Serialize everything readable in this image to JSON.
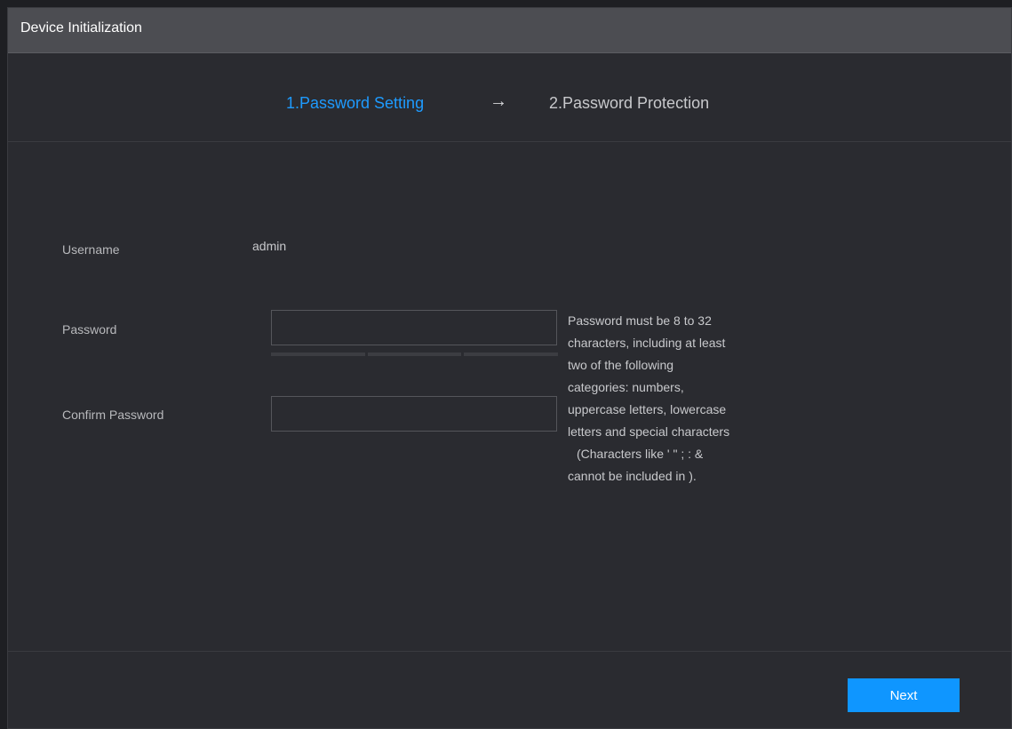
{
  "window": {
    "title": "Device Initialization"
  },
  "steps": {
    "step1": "1.Password Setting",
    "arrow": "→",
    "step2": "2.Password Protection"
  },
  "form": {
    "username_label": "Username",
    "username_value": "admin",
    "password_label": "Password",
    "password_value": "",
    "confirm_label": "Confirm Password",
    "confirm_value": "",
    "hint_lines": [
      "Password must be 8 to 32",
      "characters, including at least",
      "two of the following",
      "categories: numbers,",
      "uppercase letters, lowercase",
      "letters and special characters",
      "(Characters like ' \" ; : &",
      "cannot be included in )."
    ]
  },
  "footer": {
    "next_label": "Next"
  },
  "colors": {
    "accent": "#1e9bff",
    "button": "#0f96ff",
    "background": "#2a2b30",
    "titlebar": "#4c4d52"
  }
}
